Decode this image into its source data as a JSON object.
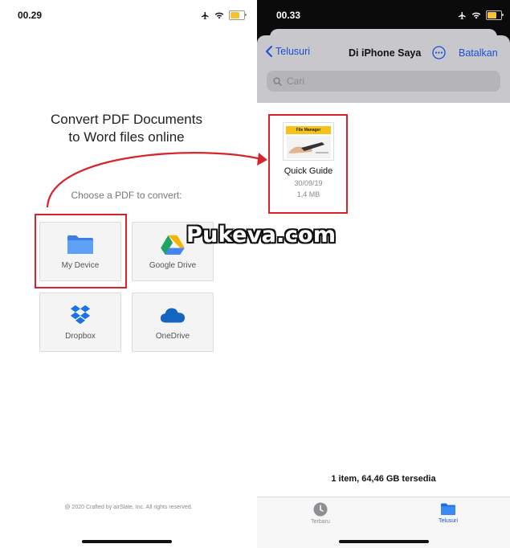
{
  "left_screen": {
    "status": {
      "time": "00.29"
    },
    "hero_title_line1": "Convert PDF Documents",
    "hero_title_line2": "to Word files online",
    "choose_label": "Choose a PDF to convert:",
    "sources": [
      {
        "label": "My Device",
        "icon": "folder-icon"
      },
      {
        "label": "Google Drive",
        "icon": "google-drive-icon"
      },
      {
        "label": "Dropbox",
        "icon": "dropbox-icon"
      },
      {
        "label": "OneDrive",
        "icon": "onedrive-icon"
      }
    ],
    "footer": "@ 2020 Crafted by airSlate, Inc. All rights reserved."
  },
  "right_screen": {
    "status": {
      "time": "00.33"
    },
    "nav": {
      "back_label": "Telusuri",
      "title": "Di iPhone Saya",
      "cancel_label": "Batalkan"
    },
    "search": {
      "placeholder": "Cari"
    },
    "file": {
      "thumbnail_banner": "File Manager",
      "name": "Quick Guide",
      "date": "30/09/19",
      "size": "1,4 MB"
    },
    "storage_info": "1 item, 64,46 GB tersedia",
    "tabs": [
      {
        "label": "Terbaru",
        "icon": "clock-icon",
        "active": false
      },
      {
        "label": "Telusuri",
        "icon": "folder-icon",
        "active": true
      }
    ]
  },
  "watermark": "Pukeva.com",
  "colors": {
    "highlight": "#d8232a",
    "ios_blue": "#1a4fd6",
    "folder_blue": "#4a8df0"
  }
}
